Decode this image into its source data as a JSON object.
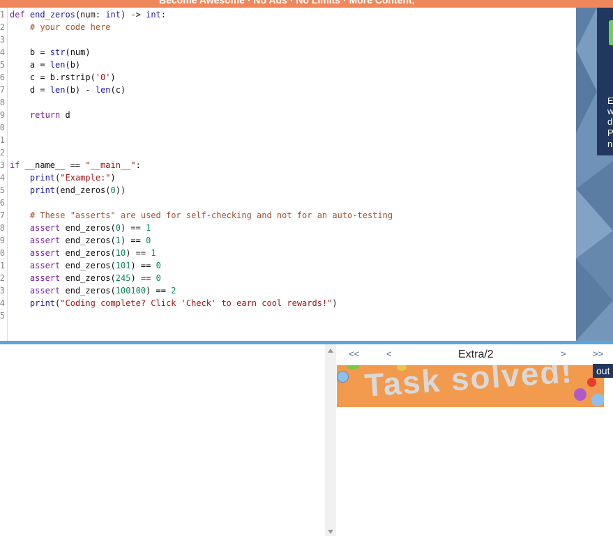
{
  "topbar": {
    "text": "Become Awesome · No Ads · No Limits · More Content,"
  },
  "editor": {
    "lines": [
      {
        "n": "1",
        "html": "<span class='kw'>def</span> <span class='fn'>end_zeros</span>(num: <span class='fn'>int</span>) -> <span class='fn'>int</span>:"
      },
      {
        "n": "2",
        "html": "    <span class='cm'># your code here</span>"
      },
      {
        "n": "3",
        "html": ""
      },
      {
        "n": "4",
        "html": "    b = <span class='fn'>str</span>(num)"
      },
      {
        "n": "5",
        "html": "    a = <span class='fn'>len</span>(b)"
      },
      {
        "n": "6",
        "html": "    c = b.rstrip(<span class='st'>'0'</span>)"
      },
      {
        "n": "7",
        "html": "    d = <span class='fn'>len</span>(b) - <span class='fn'>len</span>(c)"
      },
      {
        "n": "8",
        "html": ""
      },
      {
        "n": "9",
        "html": "    <span class='kw'>return</span> d"
      },
      {
        "n": "0",
        "html": ""
      },
      {
        "n": "1",
        "html": ""
      },
      {
        "n": "2",
        "html": ""
      },
      {
        "n": "3",
        "html": "<span class='kw'>if</span> __name__ == <span class='st'>\"__main__\"</span>:"
      },
      {
        "n": "4",
        "html": "    <span class='fn'>print</span>(<span class='st'>\"Example:\"</span>)"
      },
      {
        "n": "5",
        "html": "    <span class='fn'>print</span>(end_zeros(<span class='nm'>0</span>))"
      },
      {
        "n": "6",
        "html": ""
      },
      {
        "n": "7",
        "html": "    <span class='cm'># These \"asserts\" are used for self-checking and not for an auto-testing</span>"
      },
      {
        "n": "8",
        "html": "    <span class='kw'>assert</span> end_zeros(<span class='nm'>0</span>) == <span class='nm'>1</span>"
      },
      {
        "n": "9",
        "html": "    <span class='kw'>assert</span> end_zeros(<span class='nm'>1</span>) == <span class='nm'>0</span>"
      },
      {
        "n": "0",
        "html": "    <span class='kw'>assert</span> end_zeros(<span class='nm'>10</span>) == <span class='nm'>1</span>"
      },
      {
        "n": "1",
        "html": "    <span class='kw'>assert</span> end_zeros(<span class='nm'>101</span>) == <span class='nm'>0</span>"
      },
      {
        "n": "2",
        "html": "    <span class='kw'>assert</span> end_zeros(<span class='nm'>245</span>) == <span class='nm'>0</span>"
      },
      {
        "n": "3",
        "html": "    <span class='kw'>assert</span> end_zeros(<span class='nm'>100100</span>) == <span class='nm'>2</span>"
      },
      {
        "n": "4",
        "html": "    <span class='fn'>print</span>(<span class='st'>\"Coding complete? Click 'Check' to earn cool rewards!\"</span>)"
      },
      {
        "n": "5",
        "html": ""
      }
    ]
  },
  "sidepanel": {
    "letters": [
      "E",
      "w",
      "d",
      "P",
      "n"
    ]
  },
  "nav": {
    "first": "<<",
    "prev": "<",
    "title": "Extra/2",
    "next": ">",
    "last": ">>"
  },
  "banner": {
    "text": "Task solved!"
  },
  "output_tab": {
    "label": "out"
  },
  "colors": {
    "accent": "#f0875a",
    "divider": "#5aa6dc",
    "navy": "#22375e"
  }
}
